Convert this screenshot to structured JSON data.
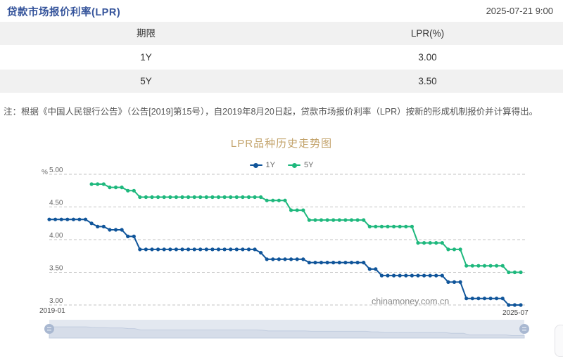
{
  "header": {
    "title": "贷款市场报价利率(LPR)",
    "datetime": "2025-07-21 9:00"
  },
  "table": {
    "columns": [
      "期限",
      "LPR(%)"
    ],
    "rows": [
      [
        "1Y",
        "3.00"
      ],
      [
        "5Y",
        "3.50"
      ]
    ]
  },
  "note": "注：根据《中国人民银行公告》（公告[2019]第15号），自2019年8月20日起，贷款市场报价利率（LPR）按新的形成机制报价并计算得出。",
  "watermark": "chinamoney.com.cn",
  "chart_data": {
    "type": "line",
    "title": "LPR品种历史走势图",
    "ylabel": "%",
    "x_start": "2019-01",
    "x_end": "2025-07",
    "x_unit": "month",
    "x_total_points": 79,
    "yticks": [
      5.0,
      4.5,
      4.0,
      3.5,
      3.0
    ],
    "ylim": [
      2.9,
      5.1
    ],
    "grid": "dashed-horizontal",
    "legend_position": "top-center",
    "series": [
      {
        "name": "1Y",
        "color": "#10559a",
        "start_index": 0,
        "values": [
          4.31,
          4.31,
          4.31,
          4.31,
          4.31,
          4.31,
          4.31,
          4.25,
          4.2,
          4.2,
          4.15,
          4.15,
          4.15,
          4.05,
          4.05,
          3.85,
          3.85,
          3.85,
          3.85,
          3.85,
          3.85,
          3.85,
          3.85,
          3.85,
          3.85,
          3.85,
          3.85,
          3.85,
          3.85,
          3.85,
          3.85,
          3.85,
          3.85,
          3.85,
          3.85,
          3.8,
          3.7,
          3.7,
          3.7,
          3.7,
          3.7,
          3.7,
          3.7,
          3.65,
          3.65,
          3.65,
          3.65,
          3.65,
          3.65,
          3.65,
          3.65,
          3.65,
          3.65,
          3.55,
          3.55,
          3.45,
          3.45,
          3.45,
          3.45,
          3.45,
          3.45,
          3.45,
          3.45,
          3.45,
          3.45,
          3.45,
          3.35,
          3.35,
          3.35,
          3.1,
          3.1,
          3.1,
          3.1,
          3.1,
          3.1,
          3.1,
          3.0,
          3.0,
          3.0
        ]
      },
      {
        "name": "5Y",
        "color": "#1eb87d",
        "start_index": 7,
        "values": [
          4.85,
          4.85,
          4.85,
          4.8,
          4.8,
          4.8,
          4.75,
          4.75,
          4.65,
          4.65,
          4.65,
          4.65,
          4.65,
          4.65,
          4.65,
          4.65,
          4.65,
          4.65,
          4.65,
          4.65,
          4.65,
          4.65,
          4.65,
          4.65,
          4.65,
          4.65,
          4.65,
          4.65,
          4.65,
          4.6,
          4.6,
          4.6,
          4.6,
          4.45,
          4.45,
          4.45,
          4.3,
          4.3,
          4.3,
          4.3,
          4.3,
          4.3,
          4.3,
          4.3,
          4.3,
          4.3,
          4.2,
          4.2,
          4.2,
          4.2,
          4.2,
          4.2,
          4.2,
          4.2,
          3.95,
          3.95,
          3.95,
          3.95,
          3.95,
          3.85,
          3.85,
          3.85,
          3.6,
          3.6,
          3.6,
          3.6,
          3.6,
          3.6,
          3.6,
          3.5,
          3.5,
          3.5
        ]
      }
    ]
  }
}
